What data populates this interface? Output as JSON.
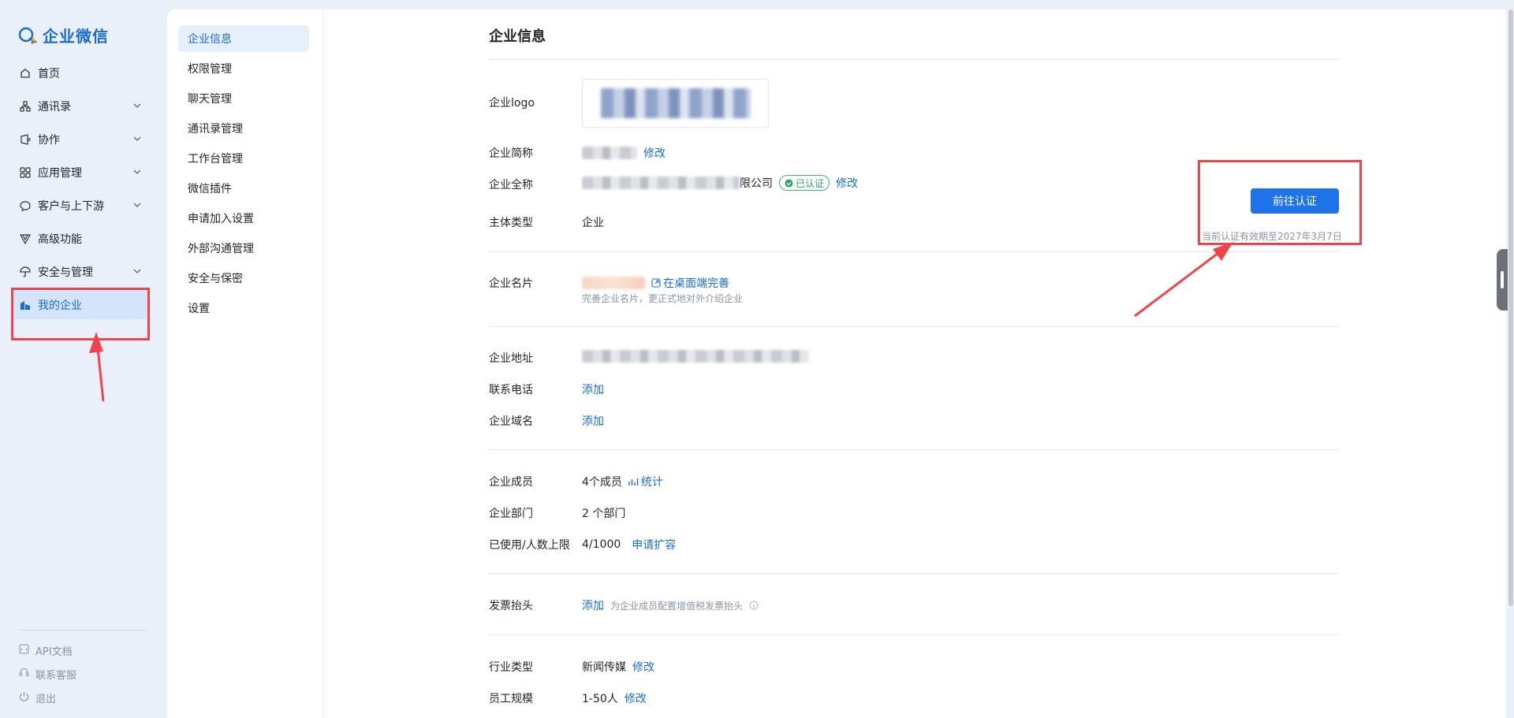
{
  "brand": {
    "name": "企业微信",
    "accent": "#1a6bd6"
  },
  "nav": {
    "items": [
      {
        "label": "首页",
        "icon": "home-icon",
        "expandable": false
      },
      {
        "label": "通讯录",
        "icon": "org-chart-icon",
        "expandable": true
      },
      {
        "label": "协作",
        "icon": "collab-icon",
        "expandable": true
      },
      {
        "label": "应用管理",
        "icon": "apps-grid-icon",
        "expandable": true
      },
      {
        "label": "客户与上下游",
        "icon": "chat-bubble-icon",
        "expandable": true
      },
      {
        "label": "高级功能",
        "icon": "advanced-icon",
        "expandable": false
      },
      {
        "label": "安全与管理",
        "icon": "umbrella-icon",
        "expandable": true
      },
      {
        "label": "我的企业",
        "icon": "enterprise-icon",
        "expandable": false,
        "active": true
      }
    ],
    "footer": [
      {
        "label": "API文档",
        "icon": "api-doc-icon"
      },
      {
        "label": "联系客服",
        "icon": "customer-service-icon"
      },
      {
        "label": "退出",
        "icon": "power-icon"
      }
    ]
  },
  "subnav": {
    "items": [
      {
        "label": "企业信息",
        "active": true
      },
      {
        "label": "权限管理"
      },
      {
        "label": "聊天管理"
      },
      {
        "label": "通讯录管理"
      },
      {
        "label": "工作台管理"
      },
      {
        "label": "微信插件"
      },
      {
        "label": "申请加入设置"
      },
      {
        "label": "外部沟通管理"
      },
      {
        "label": "安全与保密"
      },
      {
        "label": "设置"
      }
    ]
  },
  "main": {
    "title": "企业信息",
    "logo": {
      "label": "企业logo"
    },
    "short_name": {
      "label": "企业简称",
      "action": "修改"
    },
    "full_name": {
      "label": "企业全称",
      "suffix": "限公司",
      "badge": "已认证",
      "action": "修改"
    },
    "entity_type": {
      "label": "主体类型",
      "value": "企业"
    },
    "verify": {
      "button": "前往认证",
      "expire": "当前认证有效期至2027年3月7日"
    },
    "card": {
      "label": "企业名片",
      "action": "在桌面端完善",
      "hint": "完善企业名片，更正式地对外介绍企业"
    },
    "address": {
      "label": "企业地址"
    },
    "phone": {
      "label": "联系电话",
      "action": "添加"
    },
    "domain": {
      "label": "企业域名",
      "action": "添加"
    },
    "members": {
      "label": "企业成员",
      "value": "4个成员",
      "action": "统计"
    },
    "departments": {
      "label": "企业部门",
      "value": "2 个部门"
    },
    "usage": {
      "label": "已使用/人数上限",
      "value": "4/1000",
      "action": "申请扩容"
    },
    "invoice": {
      "label": "发票抬头",
      "action": "添加",
      "hint": "为企业成员配置增值税发票抬头"
    },
    "industry": {
      "label": "行业类型",
      "value": "新闻传媒",
      "action": "修改"
    },
    "scale": {
      "label": "员工规模",
      "value": "1-50人",
      "action": "修改"
    }
  }
}
